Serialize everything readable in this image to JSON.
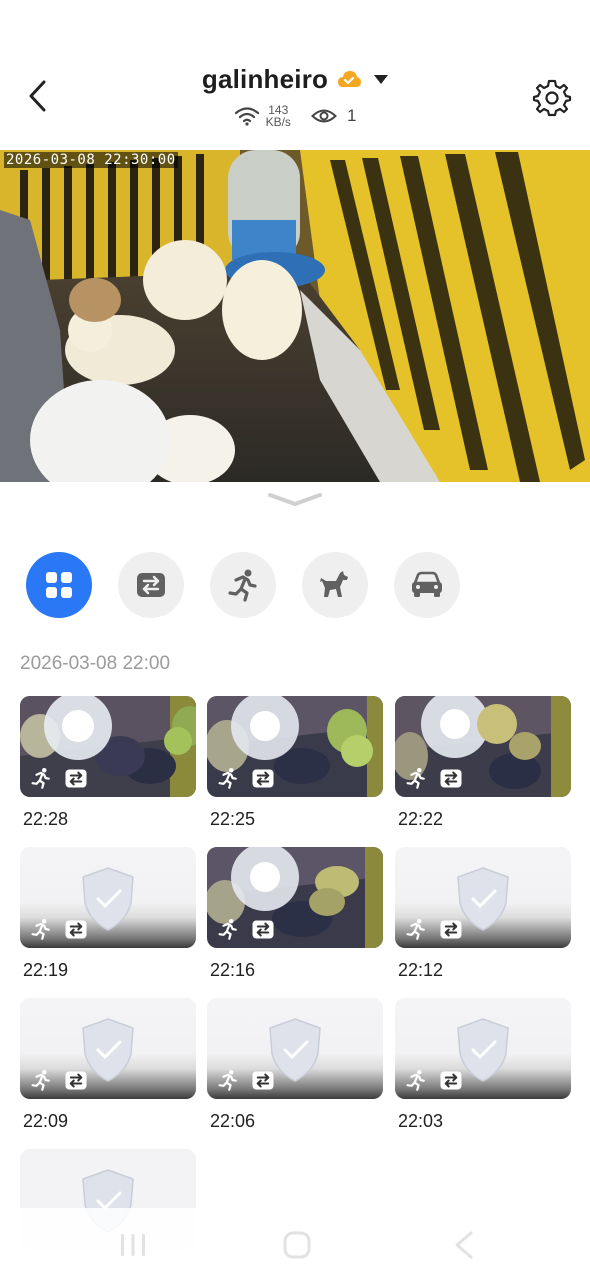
{
  "header": {
    "title": "galinheiro",
    "speed_value": "143",
    "speed_unit": "KB/s",
    "viewer_count": "1"
  },
  "video": {
    "timestamp": "2026-03-08  22:30:00"
  },
  "filters": [
    {
      "icon": "all-grid-icon",
      "active": true
    },
    {
      "icon": "motion-switch-icon",
      "active": false
    },
    {
      "icon": "person-running-icon",
      "active": false
    },
    {
      "icon": "pet-icon",
      "active": false
    },
    {
      "icon": "car-icon",
      "active": false
    }
  ],
  "events": {
    "date_header": "2026-03-08 22:00",
    "clips": [
      {
        "time": "22:28",
        "has_preview": true
      },
      {
        "time": "22:25",
        "has_preview": true
      },
      {
        "time": "22:22",
        "has_preview": true
      },
      {
        "time": "22:19",
        "has_preview": false
      },
      {
        "time": "22:16",
        "has_preview": true
      },
      {
        "time": "22:12",
        "has_preview": false
      },
      {
        "time": "22:09",
        "has_preview": false
      },
      {
        "time": "22:06",
        "has_preview": false
      },
      {
        "time": "22:03",
        "has_preview": false
      },
      {
        "time": "",
        "has_preview": false
      }
    ]
  },
  "colors": {
    "accent": "#2a78f5",
    "badge": "#f5a623",
    "filter_bg": "#efefef"
  }
}
